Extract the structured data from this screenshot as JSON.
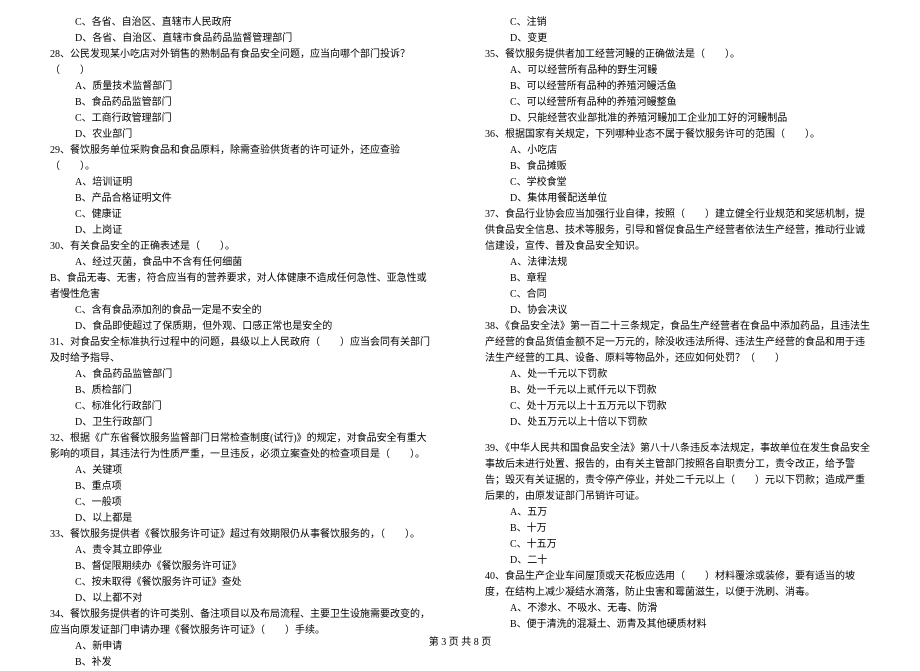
{
  "left": {
    "q27_opts_cont": [
      "C、各省、自治区、直辖市人民政府",
      "D、各省、自治区、直辖市食品药品监督管理部门"
    ],
    "q28": "28、公民发现某小吃店对外销售的熟制品有食品安全问题，应当向哪个部门投诉？（　　）",
    "q28_opts": [
      "A、质量技术监督部门",
      "B、食品药品监管部门",
      "C、工商行政管理部门",
      "D、农业部门"
    ],
    "q29": "29、餐饮服务单位采购食品和食品原料，除需查验供货者的许可证外，还应查验（　　）。",
    "q29_opts": [
      "A、培训证明",
      "B、产品合格证明文件",
      "C、健康证",
      "D、上岗证"
    ],
    "q30": "30、有关食品安全的正确表述是（　　）。",
    "q30_opts": [
      "A、经过灭菌，食品中不含有任何细菌",
      "B、食品无毒、无害，符合应当有的营养要求，对人体健康不造成任何急性、亚急性或者慢性危害",
      "C、含有食品添加剂的食品一定是不安全的",
      "D、食品即使超过了保质期，但外观、口感正常也是安全的"
    ],
    "q31": "31、对食品安全标准执行过程中的问题，县级以上人民政府（　　）应当会同有关部门及时给予指导、",
    "q31_opts": [
      "A、食品药品监管部门",
      "B、质检部门",
      "C、标准化行政部门",
      "D、卫生行政部门"
    ],
    "q32": "32、根据《广东省餐饮服务监督部门日常检查制度(试行)》的规定，对食品安全有重大影响的项目，其违法行为性质严重，一旦违反，必须立案查处的检查项目是（　　）。",
    "q32_opts": [
      "A、关键项",
      "B、重点项",
      "C、一般项",
      "D、以上都是"
    ],
    "q33": "33、餐饮服务提供者《餐饮服务许可证》超过有效期限仍从事餐饮服务的，（　　）。",
    "q33_opts": [
      "A、责令其立即停业",
      "B、督促限期续办《餐饮服务许可证》",
      "C、按未取得《餐饮服务许可证》查处",
      "D、以上都不对"
    ],
    "q34": "34、餐饮服务提供者的许可类别、备注项目以及布局流程、主要卫生设施需要改变的，应当向原发证部门申请办理《餐饮服务许可证》（　　）手续。",
    "q34_opts": [
      "A、新申请",
      "B、补发"
    ]
  },
  "right": {
    "q34_opts_cont": [
      "C、注销",
      "D、变更"
    ],
    "q35": "35、餐饮服务提供者加工经营河鳗的正确做法是（　　）。",
    "q35_opts": [
      "A、可以经营所有品种的野生河鳗",
      "B、可以经营所有品种的养殖河鳗活鱼",
      "C、可以经营所有品种的养殖河鳗整鱼",
      "D、只能经营农业部批准的养殖河鳗加工企业加工好的河鳗制品"
    ],
    "q36": "36、根据国家有关规定，下列哪种业态不属于餐饮服务许可的范围（　　）。",
    "q36_opts": [
      "A、小吃店",
      "B、食品摊贩",
      "C、学校食堂",
      "D、集体用餐配送单位"
    ],
    "q37": "37、食品行业协会应当加强行业自律，按照（　　）建立健全行业规范和奖惩机制，提供食品安全信息、技术等服务，引导和督促食品生产经营者依法生产经营，推动行业诚信建设，宣传、普及食品安全知识。",
    "q37_opts": [
      "A、法律法规",
      "B、章程",
      "C、合同",
      "D、协会决议"
    ],
    "q38": "38、《食品安全法》第一百二十三条规定，食品生产经营者在食品中添加药品，且违法生产经营的食品货值金额不足一万元的，除没收违法所得、违法生产经营的食品和用于违法生产经营的工具、设备、原料等物品外，还应如何处罚？（　　）",
    "q38_opts": [
      "A、处一千元以下罚款",
      "B、处一千元以上贰仟元以下罚款",
      "C、处十万元以上十五万元以下罚款",
      "D、处五万元以上十倍以下罚款"
    ],
    "q39": "39、《中华人民共和国食品安全法》第八十八条违反本法规定，事故单位在发生食品安全事故后未进行处置、报告的，由有关主管部门按照各自职责分工，责令改正，给予警告；毁灭有关证据的，责令停产停业，并处二千元以上（　　）元以下罚款；造成严重后果的，由原发证部门吊销许可证。",
    "q39_opts": [
      "A、五万",
      "B、十万",
      "C、十五万",
      "D、二十"
    ],
    "q40": "40、食品生产企业车间屋顶或天花板应选用（　　）材料覆涂或装修，要有适当的坡度，在结构上减少凝结水滴落，防止虫害和霉菌滋生，以便于洗刷、消毒。",
    "q40_opts": [
      "A、不渗水、不吸水、无毒、防滑",
      "B、便于清洗的混凝土、沥青及其他硬质材料"
    ]
  },
  "footer": "第 3 页 共 8 页"
}
